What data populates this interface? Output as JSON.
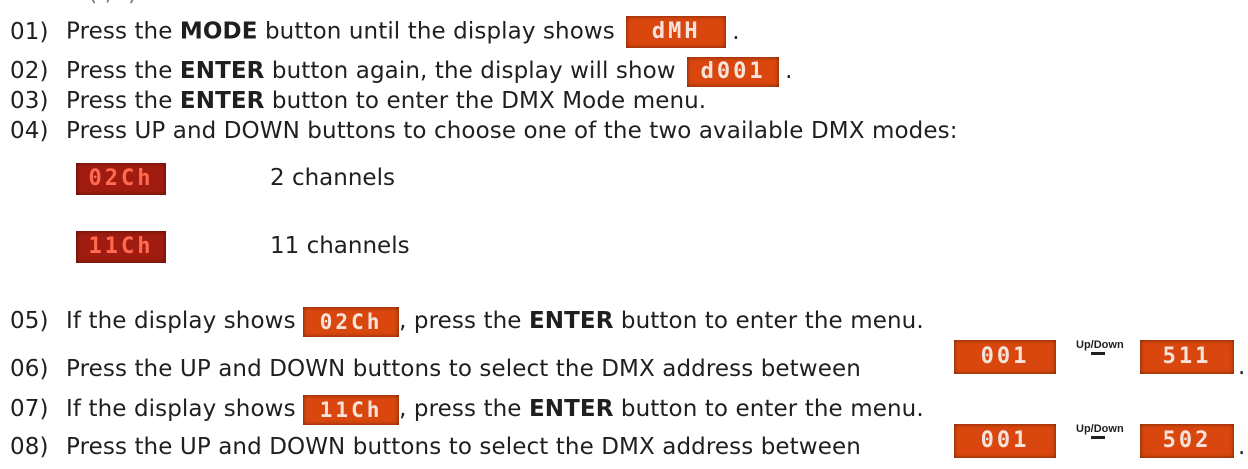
{
  "top_fragment": "...(., -)",
  "steps": [
    {
      "num": "01)",
      "pre": "Press the ",
      "bold": "MODE",
      "post": " button until the display shows ",
      "lcd": "dMH",
      "tail": "."
    },
    {
      "num": "02)",
      "pre": "Press the ",
      "bold": "ENTER",
      "post": " button again, the display will show ",
      "lcd": "d001",
      "tail": "."
    },
    {
      "num": "03)",
      "pre": "Press the ",
      "bold": "ENTER",
      "post": " button to enter the DMX Mode menu."
    },
    {
      "num": "04)",
      "text": "Press UP and DOWN buttons to choose one of the two available DMX modes:"
    },
    {
      "num": "05)",
      "pre": "If the display shows ",
      "lcd": "02Ch",
      "mid": ", press the ",
      "bold": "ENTER",
      "post": " button to enter the menu."
    },
    {
      "num": "06)",
      "text": "Press the UP and DOWN buttons to select the DMX address between",
      "lcd_from": "001",
      "lcd_to": "511",
      "tail": "."
    },
    {
      "num": "07)",
      "pre": "If the display shows ",
      "lcd": "11Ch",
      "mid": ", press the ",
      "bold": "ENTER",
      "post": " button to enter the menu."
    },
    {
      "num": "08)",
      "text": "Press the UP and DOWN buttons to select the DMX address between",
      "lcd_from": "001",
      "lcd_to": "502",
      "tail": "."
    }
  ],
  "modes": [
    {
      "lcd": "02Ch",
      "label": "2 channels"
    },
    {
      "lcd": "11Ch",
      "label": "11 channels"
    }
  ],
  "updown_label": "Up/Down",
  "colors": {
    "lcd_bg": "#b42a12",
    "lcd_text": "#ff5a3c",
    "text": "#1f1f1f"
  }
}
